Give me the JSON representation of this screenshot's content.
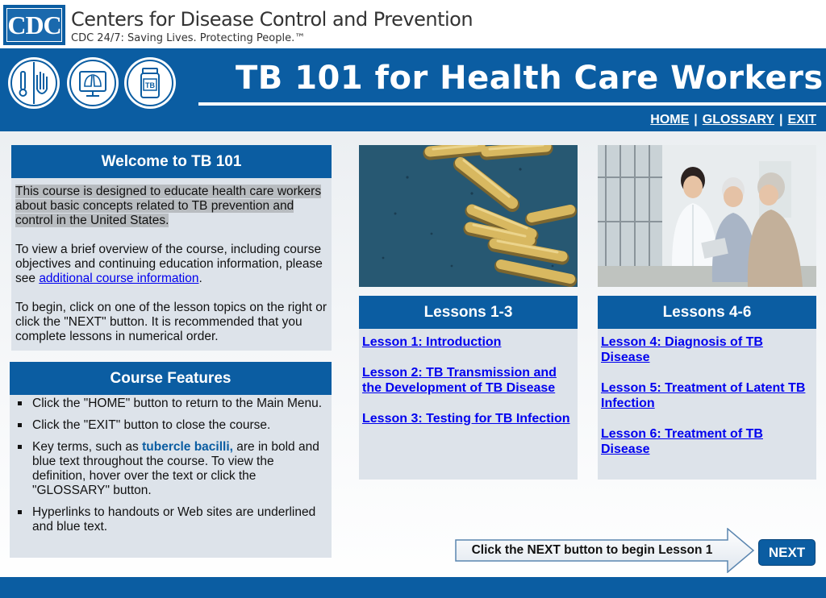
{
  "cdc": {
    "logo_text": "CDC",
    "name": "Centers for Disease Control and Prevention",
    "tagline": "CDC 24/7: Saving Lives. Protecting People.™"
  },
  "banner": {
    "title": "TB 101 for Health Care Workers",
    "icons": [
      "health-care-worker-icon",
      "lung-xray-icon",
      "tb-medicine-bottle-icon"
    ],
    "icon_bottle_label": "TB"
  },
  "nav": {
    "home": "HOME",
    "glossary": "GLOSSARY",
    "exit": "EXIT",
    "separator": "|"
  },
  "welcome": {
    "heading": "Welcome to TB 101",
    "intro": "This course is designed to educate health care workers about basic concepts related to TB prevention and control in the United States.",
    "overview_prefix": "To view a brief overview of the course, including course objectives and continuing education information, please see ",
    "overview_link": "additional course information",
    "overview_suffix": ".",
    "begin": "To begin, click on one of the lesson topics on the right or click the \"NEXT\" button. It is recommended that you complete lessons in numerical order."
  },
  "features": {
    "heading": "Course Features",
    "item1": "Click the \"HOME\" button to return to the Main Menu.",
    "item2": "Click the \"EXIT\" button to close the course.",
    "item3_prefix": "Key terms, such as ",
    "item3_term": "tubercle bacilli,",
    "item3_suffix": " are in bold and blue text throughout the course. To view the definition, hover over the text or click the \"GLOSSARY\" button.",
    "item4": "Hyperlinks to handouts or Web sites are underlined and blue text."
  },
  "lessons_a": {
    "heading": "Lessons 1-3",
    "items": [
      "Lesson 1: Introduction",
      "Lesson 2: TB Transmission and the Development of TB Disease",
      "Lesson 3: Testing for TB Infection"
    ]
  },
  "lessons_b": {
    "heading": "Lessons 4-6",
    "items": [
      "Lesson 4: Diagnosis of TB Disease",
      "Lesson 5: Treatment of Latent TB Infection",
      "Lesson 6: Treatment of TB Disease"
    ]
  },
  "footer": {
    "next_hint": "Click the NEXT button to begin Lesson 1",
    "next_label": "NEXT"
  },
  "colors": {
    "brand_blue": "#0b5da2",
    "panel_gray": "#dde3ea",
    "link_blue": "#0000ee"
  }
}
